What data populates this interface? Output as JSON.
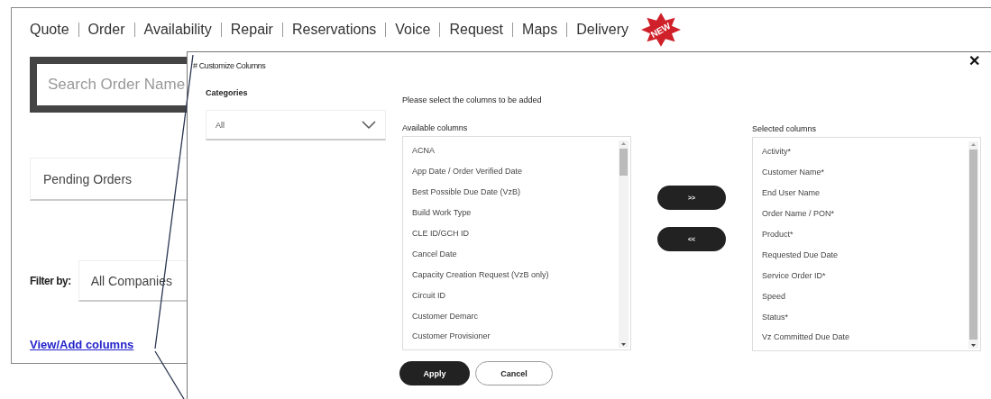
{
  "nav": {
    "items": [
      {
        "label": "Quote"
      },
      {
        "label": "Order"
      },
      {
        "label": "Availability"
      },
      {
        "label": "Repair"
      },
      {
        "label": "Reservations"
      },
      {
        "label": "Voice"
      },
      {
        "label": "Request"
      },
      {
        "label": "Maps"
      },
      {
        "label": "Delivery"
      }
    ],
    "badge": "NEW"
  },
  "search": {
    "placeholder": "Search Order Name"
  },
  "view_select": {
    "value": "Pending Orders"
  },
  "filter": {
    "label": "Filter by:",
    "value": "All Companies"
  },
  "link": "View/Add columns",
  "dialog": {
    "title": "# Customize Columns",
    "close": "✕",
    "categories": {
      "label": "Categories",
      "value": "All"
    },
    "instruction": "Please select the columns to be added",
    "available": {
      "label": "Available columns",
      "items": [
        "ACNA",
        "App Date / Order Verified Date",
        "Best Possible Due Date (VzB)",
        "Build Work Type",
        "CLE ID/GCH ID",
        "Cancel Date",
        "Capacity Creation Request (VzB only)",
        "Circuit ID",
        "Customer Demarc",
        "Customer Provisioner"
      ]
    },
    "add_button": ">>",
    "remove_button": "<<",
    "selected": {
      "label": "Selected columns",
      "items": [
        "Activity*",
        "Customer Name*",
        "End User Name",
        "Order Name / PON*",
        "Product*",
        "Requested Due Date",
        "Service Order ID*",
        "Speed",
        "Status*",
        "Vz Committed Due Date"
      ]
    },
    "buttons": [
      {
        "label": "Apply",
        "kind": "primary"
      },
      {
        "label": "Cancel",
        "kind": "secondary"
      }
    ]
  }
}
